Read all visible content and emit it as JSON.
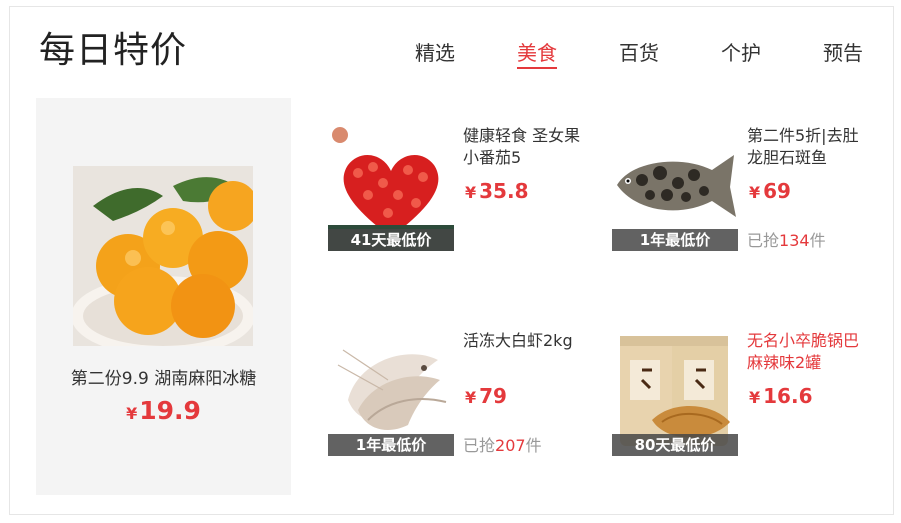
{
  "section": {
    "title": "每日特价"
  },
  "tabs": [
    {
      "label": "精选",
      "active": false
    },
    {
      "label": "美食",
      "active": true
    },
    {
      "label": "百货",
      "active": false
    },
    {
      "label": "个护",
      "active": false
    },
    {
      "label": "预告",
      "active": false
    }
  ],
  "featured": {
    "name": "第二份9.9 湖南麻阳冰糖",
    "currency": "¥",
    "price": "19.9",
    "image": "oranges-in-bowl"
  },
  "products": [
    {
      "name": "健康轻食 圣女果小番茄5",
      "currency": "¥",
      "price": "35.8",
      "badge": "41天最低价",
      "sold_prefix": "",
      "sold_count": "",
      "sold_suffix": "",
      "image": "cherry-tomato-heart",
      "name_red": false
    },
    {
      "name": "第二件5折|去肚龙胆石斑鱼",
      "currency": "¥",
      "price": "69",
      "badge": "1年最低价",
      "sold_prefix": "已抢",
      "sold_count": "134",
      "sold_suffix": "件",
      "image": "grouper-fish",
      "name_red": false
    },
    {
      "name": "活冻大白虾2kg",
      "currency": "¥",
      "price": "79",
      "badge": "1年最低价",
      "sold_prefix": "已抢",
      "sold_count": "207",
      "sold_suffix": "件",
      "image": "white-shrimp",
      "name_red": false
    },
    {
      "name": "无名小卒脆锅巴麻辣味2罐",
      "currency": "¥",
      "price": "16.6",
      "badge": "80天最低价",
      "sold_prefix": "",
      "sold_count": "",
      "sold_suffix": "",
      "image": "rice-crisp-jars",
      "name_red": true
    }
  ],
  "colors": {
    "accent": "#e4393c",
    "badge_bg": "#464646",
    "feature_bg": "#f4f4f4"
  }
}
